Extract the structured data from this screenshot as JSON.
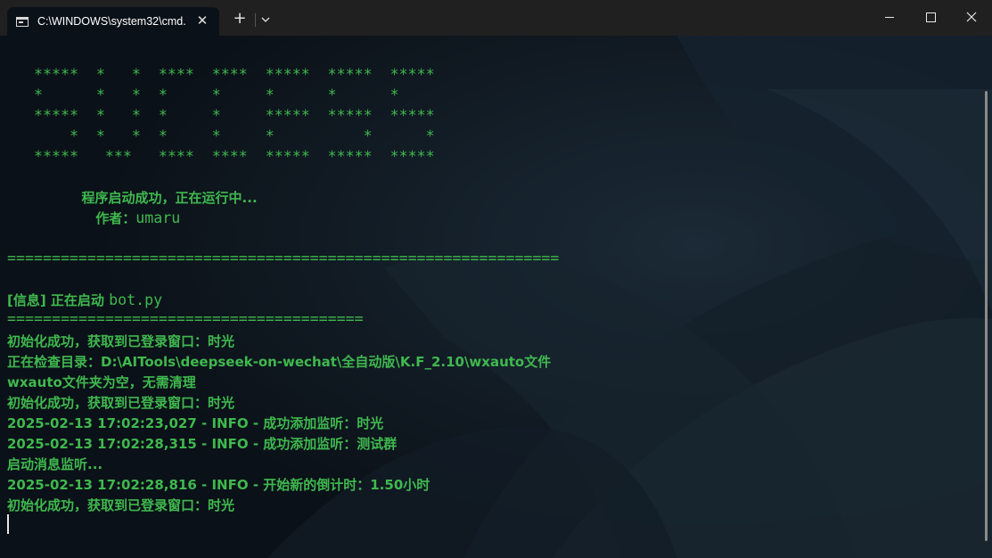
{
  "window": {
    "tab_title": "C:\\WINDOWS\\system32\\cmd.",
    "tab_icon": "cmd-icon",
    "new_tab_label": "+",
    "close_tab_label": "✕",
    "close_window_label": "✕"
  },
  "terminal": {
    "text_color": "#3fb84e",
    "banner": [
      "*****  *   *  ****  ****  *****  *****  *****",
      "*      *   *  *     *     *      *      *",
      "*****  *   *  *     *     *****  *****  *****",
      "    *  *   *  *     *     *          *      *",
      "*****   ***   ****  ****  *****  *****  *****"
    ],
    "status_line": "                程序启动成功，正在运行中...",
    "author_label": "                   作者：",
    "author_name": "umaru",
    "divider_long": "==============================================================",
    "info_line_tag": "[信息] 正在启动 ",
    "info_line_file": "bot.py",
    "divider_short": "========================================",
    "log": [
      "初始化成功，获取到已登录窗口：时光",
      "正在检查目录：D:\\AITools\\deepseek-on-wechat\\全自动版\\K.F_2.10\\wxauto文件",
      "wxauto文件夹为空，无需清理",
      "初始化成功，获取到已登录窗口：时光",
      "2025-02-13 17:02:23,027 - INFO - 成功添加监听：时光",
      "2025-02-13 17:02:28,315 - INFO - 成功添加监听：测试群",
      "启动消息监听...",
      "2025-02-13 17:02:28,816 - INFO - 开始新的倒计时：1.50小时",
      "初始化成功，获取到已登录窗口：时光"
    ]
  }
}
